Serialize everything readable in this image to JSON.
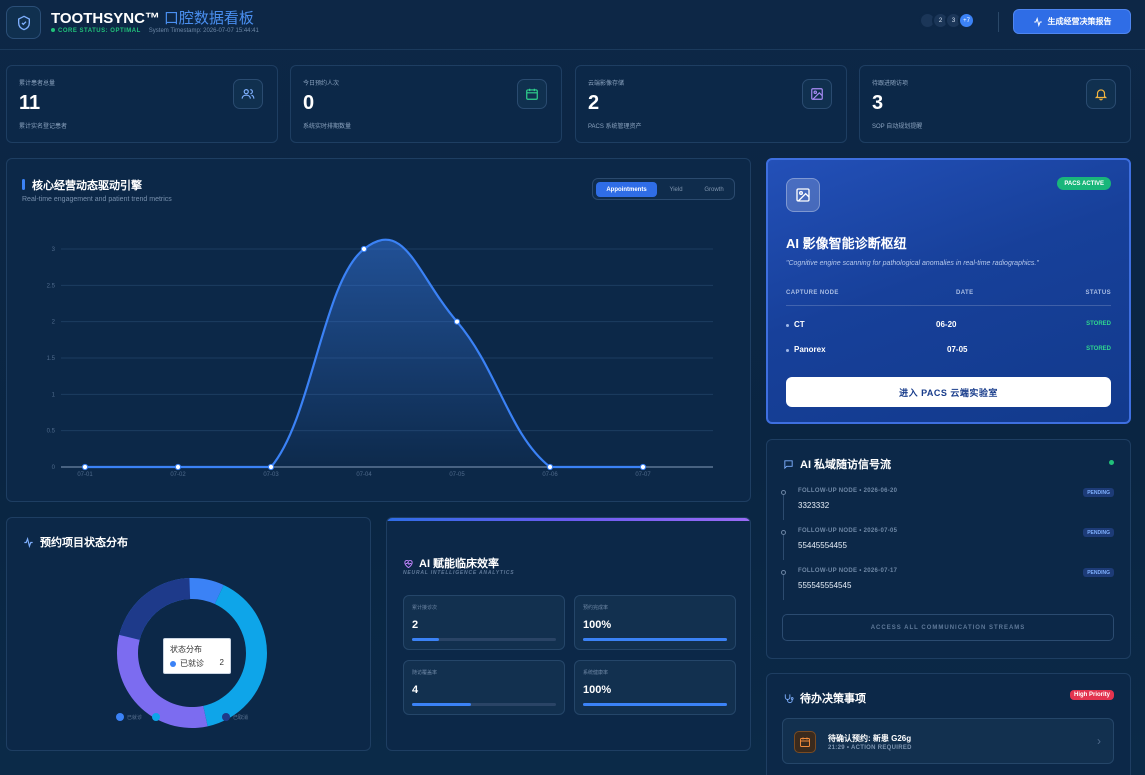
{
  "header": {
    "brand": "TOOTHSYNC™",
    "subtitle": "口腔数据看板",
    "status": "CORE STATUS: OPTIMAL",
    "timestamp": "System Timestamp: 2026-07-07 15:44:41",
    "avatars": [
      "",
      "2",
      "3",
      "+7"
    ],
    "report_button": "生成经营决策报告"
  },
  "stats": [
    {
      "label": "累计患者总量",
      "value": "11",
      "desc": "累计实名登记患者",
      "icon": "users-icon",
      "color": "#7fb0ff"
    },
    {
      "label": "今日预约人次",
      "value": "0",
      "desc": "系统实时排期数量",
      "icon": "calendar-icon",
      "color": "#2fd58f"
    },
    {
      "label": "云端影像存储",
      "value": "2",
      "desc": "PACS 系统管理资产",
      "icon": "image-icon",
      "color": "#a98cf7"
    },
    {
      "label": "待跟进随访项",
      "value": "3",
      "desc": "SOP 自动规划提醒",
      "icon": "bell-icon",
      "color": "#f3b53f"
    }
  ],
  "engine": {
    "title": "核心经营动态驱动引擎",
    "subtitle": "Real-time engagement and patient trend metrics",
    "tabs": [
      "Appointments",
      "Yield",
      "Growth"
    ]
  },
  "chart_data": {
    "type": "area",
    "x": [
      "07-01",
      "07-02",
      "07-03",
      "07-04",
      "07-05",
      "07-06",
      "07-07"
    ],
    "values": [
      0,
      0,
      0,
      3,
      2,
      0,
      0
    ],
    "ylim": [
      0,
      3
    ],
    "yticks": [
      "0",
      "0.5",
      "1",
      "1.5",
      "2",
      "2.5",
      "3"
    ],
    "grid": true,
    "color": "#3b82f6"
  },
  "pacs": {
    "badge": "PACS ACTIVE",
    "title": "AI 影像智能诊断枢纽",
    "quote": "\"Cognitive engine scanning for pathological anomalies in real-time radiographics.\"",
    "columns": [
      "CAPTURE NODE",
      "DATE",
      "STATUS"
    ],
    "rows": [
      {
        "node": "CT",
        "date": "06-20",
        "status": "STORED"
      },
      {
        "node": "Panorex",
        "date": "07-05",
        "status": "STORED"
      }
    ],
    "button": "进入 PACS 云端实验室"
  },
  "followup": {
    "title": "AI 私域随访信号流",
    "items": [
      {
        "label": "FOLLOW-UP NODE • 2026-06-20",
        "value": "3323332",
        "status": "PENDING"
      },
      {
        "label": "FOLLOW-UP NODE • 2026-07-05",
        "value": "55445554455",
        "status": "PENDING"
      },
      {
        "label": "FOLLOW-UP NODE • 2026-07-17",
        "value": "555545554545",
        "status": "PENDING"
      }
    ],
    "button": "ACCESS ALL COMMUNICATION STREAMS"
  },
  "todo": {
    "title": "待办决策事项",
    "priority": "High Priority",
    "item_main": "待确认预约: 新患 G26g",
    "item_meta": "21:29 • ACTION REQUIRED"
  },
  "distribution": {
    "title": "预约项目状态分布",
    "tooltip_title": "状态分布",
    "tooltip_name": "已就诊",
    "tooltip_value": "2",
    "legend": [
      {
        "name": "已就诊",
        "color": "#3b82f6"
      },
      {
        "name": "",
        "color": "#0ea5e9"
      },
      {
        "name": "",
        "color": "#7c6cf0"
      },
      {
        "name": "已取消",
        "color": "#1e3a8a"
      }
    ]
  },
  "efficiency": {
    "title": "AI 赋能临床效率",
    "subtitle": "NEURAL INTELLIGENCE ANALYTICS",
    "metrics": [
      {
        "label": "累计接诊次",
        "value": "2",
        "progress": 0.19
      },
      {
        "label": "预约完成率",
        "value": "100%",
        "progress": 1.0
      },
      {
        "label": "随访覆盖率",
        "value": "4",
        "progress": 0.41
      },
      {
        "label": "系统健康率",
        "value": "100%",
        "progress": 1.0
      }
    ]
  }
}
